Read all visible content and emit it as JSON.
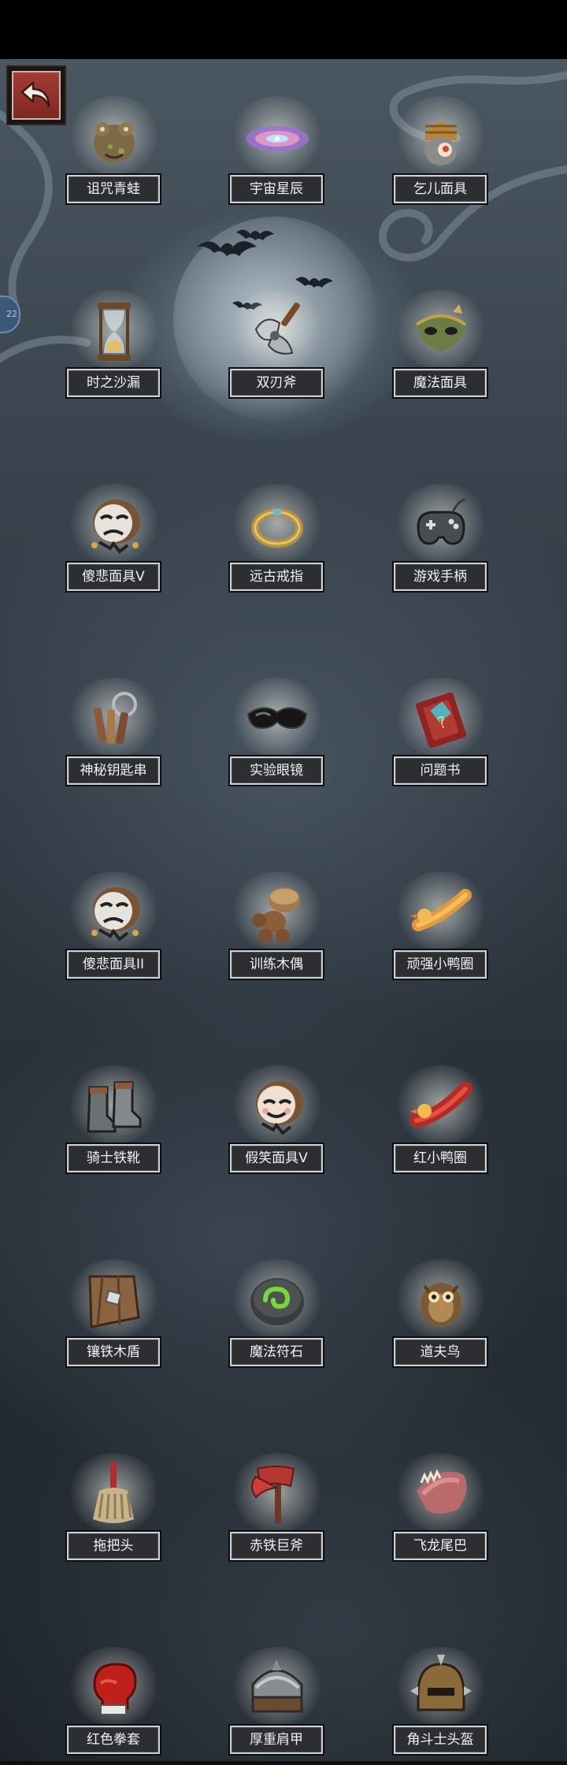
{
  "side_tab": {
    "text": "22"
  },
  "items": [
    {
      "label": "诅咒青蛙",
      "icon": "cursed-frog-icon"
    },
    {
      "label": "宇宙星辰",
      "icon": "galaxy-icon"
    },
    {
      "label": "乞儿面具",
      "icon": "beggar-mask-icon"
    },
    {
      "label": "时之沙漏",
      "icon": "hourglass-icon"
    },
    {
      "label": "双刃斧",
      "icon": "double-axe-icon"
    },
    {
      "label": "魔法面具",
      "icon": "magic-mask-icon"
    },
    {
      "label": "傻悲面具V",
      "icon": "sad-mask-icon"
    },
    {
      "label": "远古戒指",
      "icon": "ancient-ring-icon"
    },
    {
      "label": "游戏手柄",
      "icon": "gamepad-icon"
    },
    {
      "label": "神秘钥匙串",
      "icon": "keychain-icon"
    },
    {
      "label": "实验眼镜",
      "icon": "goggles-icon"
    },
    {
      "label": "问题书",
      "icon": "question-book-icon"
    },
    {
      "label": "傻悲面具II",
      "icon": "sad-mask-icon"
    },
    {
      "label": "训练木偶",
      "icon": "training-dummy-icon"
    },
    {
      "label": "顽强小鸭圈",
      "icon": "duck-ring-icon"
    },
    {
      "label": "骑士铁靴",
      "icon": "iron-boots-icon"
    },
    {
      "label": "假笑面具V",
      "icon": "smile-mask-icon"
    },
    {
      "label": "红小鸭圈",
      "icon": "red-duck-ring-icon"
    },
    {
      "label": "镶铁木盾",
      "icon": "wooden-shield-icon"
    },
    {
      "label": "魔法符石",
      "icon": "rune-stone-icon"
    },
    {
      "label": "道夫鸟",
      "icon": "owl-icon"
    },
    {
      "label": "拖把头",
      "icon": "mop-head-icon"
    },
    {
      "label": "赤铁巨斧",
      "icon": "red-axe-icon"
    },
    {
      "label": "飞龙尾巴",
      "icon": "dragon-tail-icon"
    },
    {
      "label": "红色拳套",
      "icon": "boxing-glove-icon"
    },
    {
      "label": "厚重肩甲",
      "icon": "pauldron-icon"
    },
    {
      "label": "角斗士头盔",
      "icon": "gladiator-helmet-icon"
    }
  ]
}
